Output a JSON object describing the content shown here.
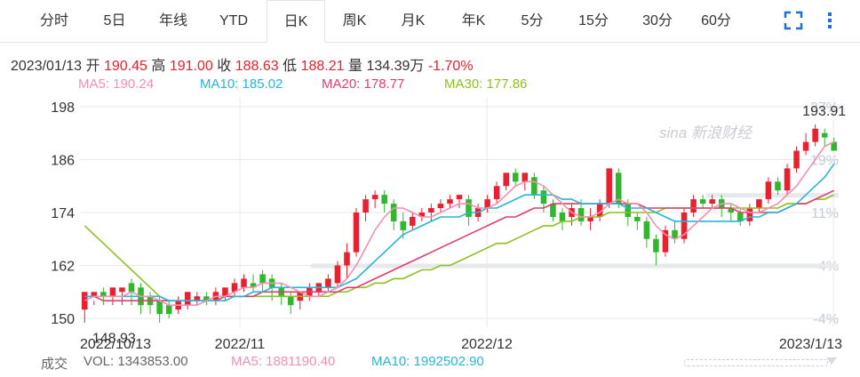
{
  "tabs": [
    "分时",
    "5日",
    "年线",
    "YTD",
    "日K",
    "周K",
    "月K",
    "年K",
    "5分",
    "15分",
    "30分",
    "60分"
  ],
  "active_tab": "日K",
  "icons": [
    "fullscreen-icon",
    "more-vertical-icon"
  ],
  "info": {
    "date": "2023/01/13",
    "open_label": "开",
    "open": "190.45",
    "high_label": "高",
    "high": "191.00",
    "close_label": "收",
    "close": "188.63",
    "low_label": "低",
    "low": "188.21",
    "vol_label": "量",
    "vol": "134.39万",
    "change": "-1.70%"
  },
  "ma_legend": {
    "ma5": "MA5: 190.24",
    "ma10": "MA10: 185.02",
    "ma20": "MA20: 178.77",
    "ma30": "MA30: 177.86"
  },
  "volume_legend": {
    "label": "成交",
    "vol": "VOL: 1343853.00",
    "ma5": "MA5: 1881190.40",
    "ma10": "MA10: 1992502.90"
  },
  "watermark": "sina 新浪财经",
  "colors": {
    "up": "#e8202f",
    "down": "#2fb82d",
    "ma5": "#f28fb5",
    "ma10": "#27b6d6",
    "ma20": "#e33d6f",
    "ma30": "#8cc21f"
  },
  "chart_data": {
    "type": "candlestick",
    "y_ticks": [
      "198",
      "186",
      "174",
      "162",
      "150"
    ],
    "right_ticks": [
      "27%",
      "19%",
      "11%",
      "4%",
      "-4%"
    ],
    "ylim": [
      148,
      200
    ],
    "x_tick_labels": [
      "2022/10/13",
      "2022/11",
      "2022/12",
      "2023/1/13"
    ],
    "max_label": "193.91",
    "min_label": "148.93",
    "candles": [
      [
        152,
        156,
        149,
        155
      ],
      [
        155,
        156,
        153,
        154
      ],
      [
        156,
        155,
        153,
        157
      ],
      [
        155,
        157,
        153,
        157
      ],
      [
        156,
        157,
        153,
        156
      ],
      [
        158,
        156,
        153,
        159
      ],
      [
        157,
        153,
        151,
        158
      ],
      [
        155,
        153,
        151,
        156
      ],
      [
        154,
        151,
        149,
        155
      ],
      [
        153,
        151,
        150,
        154
      ],
      [
        152,
        154,
        151,
        155
      ],
      [
        153,
        156,
        152,
        156
      ],
      [
        154,
        155,
        153,
        156
      ],
      [
        155,
        154,
        153,
        156
      ],
      [
        154,
        156,
        153,
        157
      ],
      [
        155,
        157,
        154,
        157
      ],
      [
        156,
        158,
        155,
        159
      ],
      [
        157,
        159,
        156,
        160
      ],
      [
        158,
        157,
        156,
        160
      ],
      [
        160,
        158,
        156,
        161
      ],
      [
        159,
        157,
        154,
        160
      ],
      [
        157,
        155,
        153,
        158
      ],
      [
        155,
        153,
        151,
        156
      ],
      [
        154,
        156,
        152,
        156
      ],
      [
        155,
        157,
        154,
        158
      ],
      [
        156,
        158,
        155,
        158
      ],
      [
        157,
        159,
        156,
        160
      ],
      [
        158,
        162,
        157,
        163
      ],
      [
        162,
        165,
        159,
        167
      ],
      [
        165,
        174,
        164,
        175
      ],
      [
        174,
        177,
        172,
        178
      ],
      [
        177,
        178,
        175,
        179
      ],
      [
        178,
        176,
        174,
        179
      ],
      [
        176,
        172,
        170,
        177
      ],
      [
        172,
        170,
        168,
        174
      ],
      [
        171,
        173,
        170,
        174
      ],
      [
        173,
        174,
        172,
        175
      ],
      [
        174,
        175,
        172,
        176
      ],
      [
        175,
        176,
        174,
        177
      ],
      [
        176,
        177,
        175,
        178
      ],
      [
        177,
        178,
        175,
        178
      ],
      [
        177,
        173,
        171,
        178
      ],
      [
        173,
        175,
        172,
        176
      ],
      [
        175,
        177,
        174,
        178
      ],
      [
        177,
        180,
        176,
        181
      ],
      [
        180,
        183,
        179,
        183
      ],
      [
        183,
        181,
        180,
        184
      ],
      [
        181,
        183,
        179,
        183
      ],
      [
        182,
        178,
        177,
        183
      ],
      [
        179,
        176,
        174,
        180
      ],
      [
        176,
        173,
        172,
        177
      ],
      [
        174,
        172,
        170,
        175
      ],
      [
        173,
        175,
        171,
        176
      ],
      [
        175,
        172,
        171,
        177
      ],
      [
        172,
        173,
        170,
        175
      ],
      [
        173,
        176,
        172,
        177
      ],
      [
        176,
        184,
        175,
        184
      ],
      [
        183,
        176,
        175,
        184
      ],
      [
        176,
        173,
        171,
        177
      ],
      [
        173,
        172,
        170,
        174
      ],
      [
        172,
        168,
        166,
        173
      ],
      [
        168,
        165,
        162,
        169
      ],
      [
        165,
        170,
        164,
        171
      ],
      [
        170,
        168,
        167,
        172
      ],
      [
        168,
        174,
        167,
        175
      ],
      [
        174,
        177,
        173,
        178
      ],
      [
        177,
        176,
        175,
        178
      ],
      [
        176,
        177,
        175,
        178
      ],
      [
        177,
        175,
        173,
        178
      ],
      [
        175,
        174,
        172,
        176
      ],
      [
        174,
        172,
        171,
        175
      ],
      [
        172,
        175,
        171,
        176
      ],
      [
        175,
        177,
        174,
        177
      ],
      [
        177,
        181,
        176,
        182
      ],
      [
        181,
        179,
        178,
        182
      ],
      [
        179,
        184,
        178,
        185
      ],
      [
        184,
        188,
        183,
        189
      ],
      [
        188,
        190,
        187,
        192
      ],
      [
        190,
        193,
        189,
        194
      ],
      [
        192,
        191,
        189,
        193
      ],
      [
        190,
        188,
        188,
        191
      ]
    ],
    "ma5": [
      154,
      155,
      155,
      155,
      155,
      156,
      155,
      155,
      154,
      153,
      153,
      153,
      153,
      154,
      155,
      155,
      156,
      157,
      157,
      158,
      158,
      158,
      157,
      156,
      155,
      155,
      156,
      157,
      159,
      162,
      166,
      170,
      173,
      175,
      175,
      174,
      173,
      173,
      174,
      175,
      176,
      176,
      175,
      175,
      176,
      178,
      180,
      181,
      181,
      180,
      178,
      176,
      174,
      173,
      173,
      174,
      176,
      177,
      176,
      176,
      174,
      171,
      169,
      168,
      169,
      171,
      173,
      175,
      176,
      176,
      175,
      174,
      174,
      175,
      176,
      178,
      180,
      183,
      186,
      189,
      190
    ],
    "ma10": [
      155,
      155,
      155,
      155,
      155,
      155,
      155,
      155,
      155,
      154,
      154,
      154,
      154,
      154,
      154,
      154,
      155,
      155,
      156,
      156,
      157,
      157,
      157,
      157,
      157,
      157,
      157,
      157,
      158,
      159,
      161,
      163,
      165,
      167,
      169,
      170,
      171,
      172,
      173,
      173,
      173,
      174,
      174,
      175,
      175,
      176,
      177,
      178,
      178,
      178,
      178,
      177,
      177,
      176,
      176,
      176,
      176,
      176,
      175,
      175,
      175,
      174,
      173,
      172,
      172,
      172,
      172,
      172,
      172,
      172,
      172,
      173,
      173,
      174,
      174,
      175,
      176,
      178,
      180,
      182,
      185
    ],
    "ma20": [
      155,
      155,
      154,
      154,
      154,
      154,
      154,
      154,
      154,
      154,
      154,
      154,
      154,
      154,
      154,
      155,
      155,
      155,
      155,
      156,
      156,
      156,
      156,
      156,
      156,
      156,
      156,
      156,
      157,
      157,
      158,
      159,
      160,
      161,
      162,
      163,
      164,
      165,
      166,
      167,
      168,
      169,
      170,
      171,
      172,
      173,
      173,
      174,
      175,
      175,
      176,
      176,
      176,
      176,
      176,
      176,
      176,
      176,
      176,
      176,
      175,
      175,
      175,
      175,
      175,
      175,
      175,
      175,
      175,
      175,
      174,
      174,
      174,
      174,
      174,
      175,
      176,
      176,
      177,
      178,
      179
    ],
    "ma30": [
      171,
      169,
      167,
      165,
      163,
      161,
      159,
      157,
      155,
      154,
      154,
      154,
      154,
      154,
      154,
      155,
      155,
      155,
      155,
      155,
      155,
      155,
      155,
      155,
      155,
      155,
      155,
      156,
      156,
      157,
      157,
      158,
      158,
      159,
      159,
      160,
      161,
      161,
      162,
      162,
      163,
      164,
      165,
      166,
      167,
      167,
      168,
      169,
      170,
      171,
      171,
      172,
      172,
      173,
      173,
      173,
      174,
      174,
      174,
      174,
      174,
      174,
      175,
      175,
      175,
      175,
      175,
      175,
      175,
      175,
      175,
      175,
      175,
      175,
      175,
      176,
      176,
      176,
      177,
      177,
      178
    ]
  }
}
